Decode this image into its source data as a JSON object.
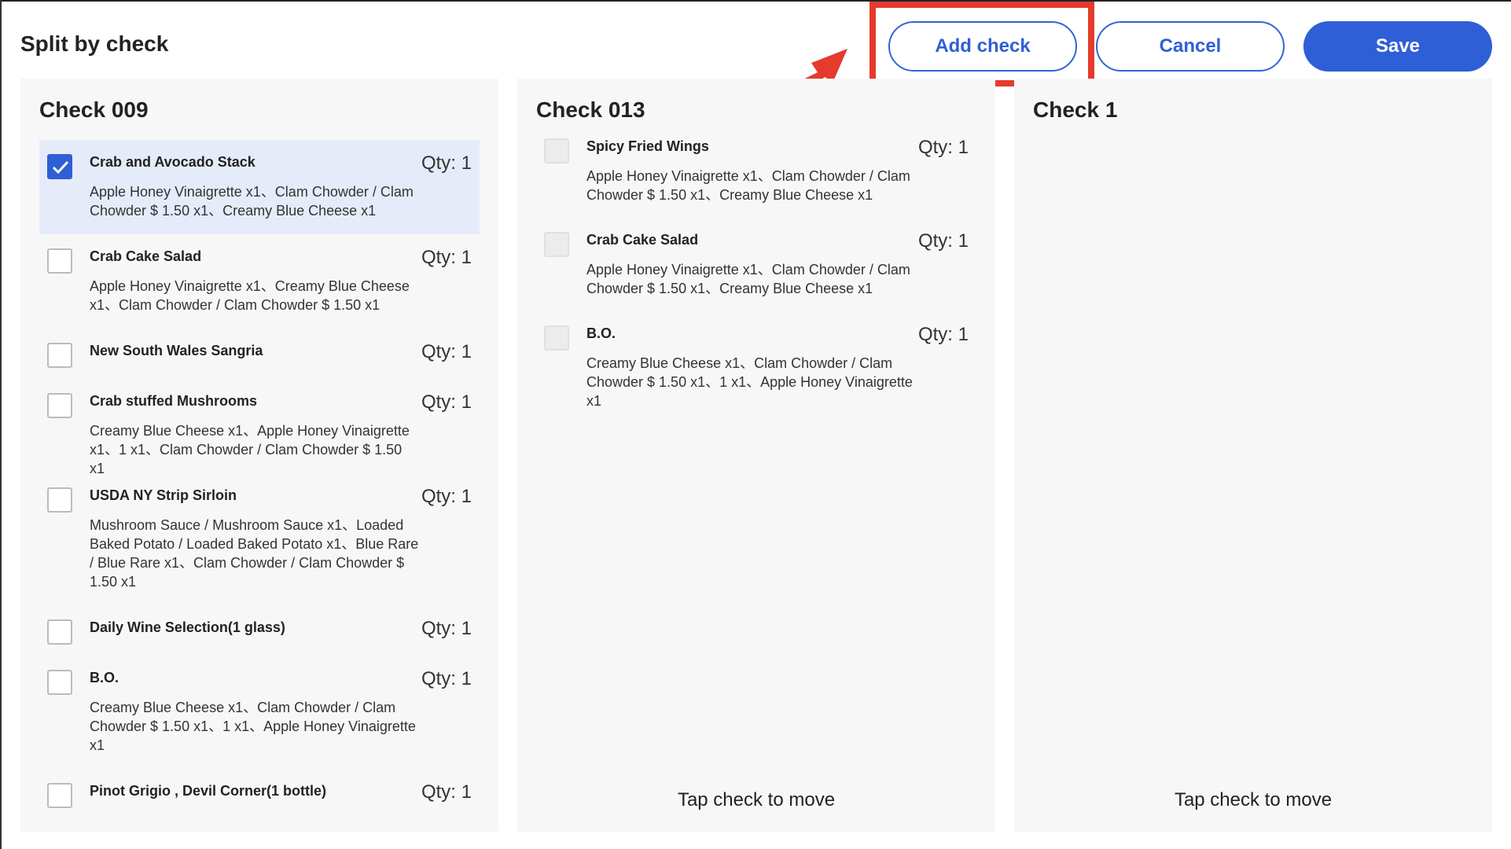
{
  "header": {
    "title": "Split by check",
    "add_check_label": "Add check",
    "cancel_label": "Cancel",
    "save_label": "Save"
  },
  "colors": {
    "accent": "#2f5fd6",
    "annotation_red": "#e43b2d",
    "selected_row_bg": "#e6ebf9"
  },
  "checks": [
    {
      "title": "Check 009",
      "items": [
        {
          "name": "Crab and Avocado Stack",
          "qty": "Qty: 1",
          "mods": "Apple Honey Vinaigrette x1、Clam Chowder / Clam Chowder $ 1.50 x1、Creamy Blue Cheese x1",
          "checked": true
        },
        {
          "name": "Crab Cake Salad",
          "qty": "Qty: 1",
          "mods": "Apple Honey Vinaigrette x1、Creamy Blue Cheese x1、Clam Chowder / Clam Chowder $ 1.50 x1",
          "checked": false
        },
        {
          "name": "New South Wales Sangria",
          "qty": "Qty: 1",
          "mods": "",
          "checked": false
        },
        {
          "name": "Crab stuffed Mushrooms",
          "qty": "Qty: 1",
          "mods": "Creamy Blue Cheese x1、Apple Honey Vinaigrette x1、1 x1、Clam Chowder / Clam Chowder $ 1.50 x1",
          "checked": false
        },
        {
          "name": "USDA NY Strip Sirloin",
          "qty": "Qty: 1",
          "mods": "Mushroom Sauce / Mushroom Sauce x1、Loaded Baked Potato / Loaded Baked Potato x1、Blue Rare / Blue Rare x1、Clam Chowder / Clam Chowder $ 1.50 x1",
          "checked": false
        },
        {
          "name": "Daily Wine Selection(1 glass)",
          "qty": "Qty: 1",
          "mods": "",
          "checked": false
        },
        {
          "name": "B.O.",
          "qty": "Qty: 1",
          "mods": "Creamy Blue Cheese x1、Clam Chowder / Clam Chowder $ 1.50 x1、1 x1、Apple Honey Vinaigrette x1",
          "checked": false
        },
        {
          "name": "Pinot Grigio , Devil Corner(1 bottle)",
          "qty": "Qty: 1",
          "mods": "",
          "checked": false
        }
      ]
    },
    {
      "title": "Check 013",
      "items": [
        {
          "name": "Spicy Fried Wings",
          "qty": "Qty: 1",
          "mods": "Apple Honey Vinaigrette x1、Clam Chowder / Clam Chowder $ 1.50 x1、Creamy Blue Cheese x1",
          "checked": false
        },
        {
          "name": "Crab Cake Salad",
          "qty": "Qty: 1",
          "mods": "Apple Honey Vinaigrette x1、Clam Chowder / Clam Chowder $ 1.50 x1、Creamy Blue Cheese x1",
          "checked": false
        },
        {
          "name": "B.O.",
          "qty": "Qty: 1",
          "mods": "Creamy Blue Cheese x1、Clam Chowder / Clam Chowder $ 1.50 x1、1 x1、Apple Honey Vinaigrette x1",
          "checked": false
        }
      ],
      "hint": "Tap check to move"
    },
    {
      "title": "Check 1",
      "items": [],
      "hint": "Tap check to move"
    }
  ]
}
